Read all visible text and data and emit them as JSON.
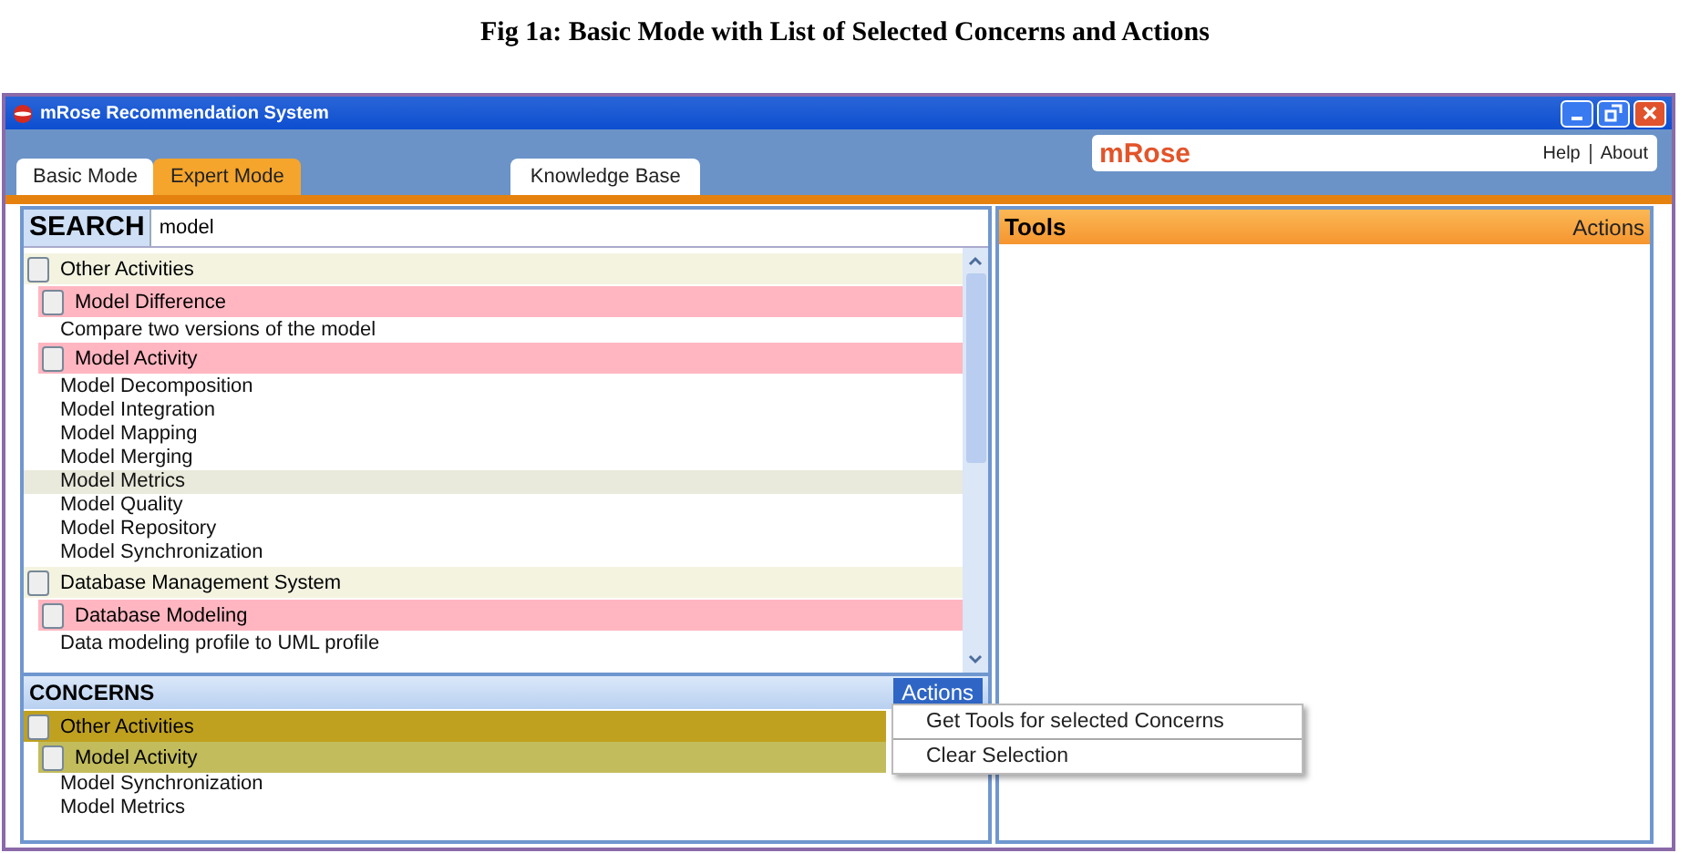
{
  "caption": "Fig 1a: Basic Mode with List of Selected Concerns and Actions",
  "window": {
    "title": "mRose Recommendation System"
  },
  "tabs": [
    {
      "label": "Basic Mode",
      "selected": false
    },
    {
      "label": "Expert Mode",
      "selected": true
    },
    {
      "label": "Knowledge Base",
      "selected": false
    }
  ],
  "brand": {
    "logo": "mRose",
    "links": [
      "Help",
      "About"
    ]
  },
  "search": {
    "label": "SEARCH",
    "value": "model"
  },
  "tree": [
    {
      "label": "Other Activities",
      "checked": false,
      "children": [
        {
          "label": "Model Difference",
          "checked": false,
          "children": [
            {
              "label": "Compare two versions of the model",
              "selected": false
            }
          ]
        },
        {
          "label": "Model Activity",
          "checked": false,
          "children": [
            {
              "label": "Model Decomposition",
              "selected": false
            },
            {
              "label": "Model Integration",
              "selected": false
            },
            {
              "label": "Model Mapping",
              "selected": false
            },
            {
              "label": "Model Merging",
              "selected": false
            },
            {
              "label": "Model Metrics",
              "selected": true
            },
            {
              "label": "Model Quality",
              "selected": false
            },
            {
              "label": "Model Repository",
              "selected": false
            },
            {
              "label": "Model Synchronization",
              "selected": false
            }
          ]
        }
      ]
    },
    {
      "label": "Database Management System",
      "checked": false,
      "children": [
        {
          "label": "Database Modeling",
          "checked": false,
          "children": [
            {
              "label": "Data modeling profile to UML profile",
              "selected": false
            }
          ]
        }
      ]
    }
  ],
  "concerns": {
    "title": "CONCERNS",
    "actions": "Actions",
    "items": [
      {
        "label": "Other Activities",
        "checked": false,
        "children": [
          {
            "label": "Model Activity",
            "checked": false,
            "children": [
              {
                "label": "Model Synchronization",
                "selected": false
              },
              {
                "label": "Model Metrics",
                "selected": false
              }
            ]
          }
        ]
      }
    ]
  },
  "tools": {
    "title": "Tools",
    "actions": "Actions"
  },
  "menu": {
    "items": [
      "Get Tools for selected Concerns",
      "Clear Selection"
    ]
  }
}
